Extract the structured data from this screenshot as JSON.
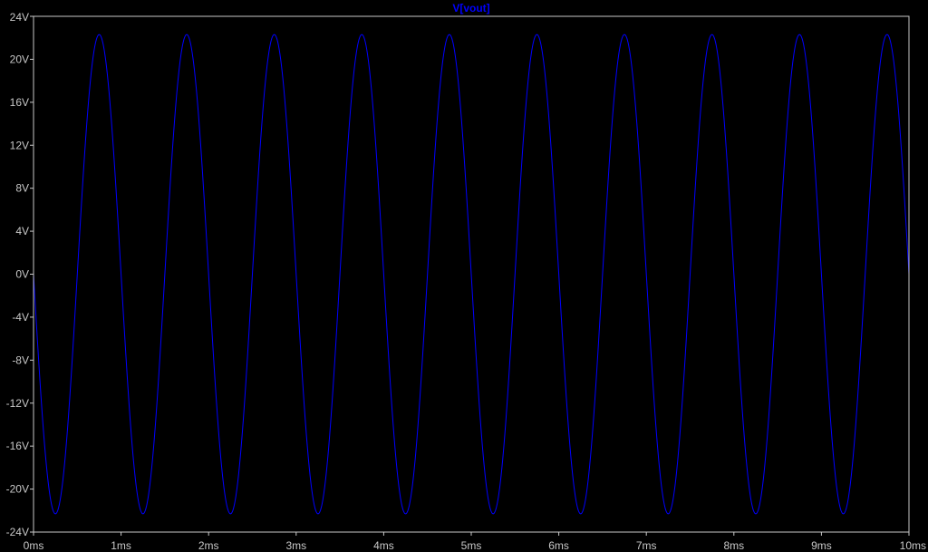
{
  "chart_data": {
    "type": "line",
    "title": "V[vout]",
    "xlabel": "",
    "ylabel": "",
    "x_unit": "ms",
    "y_unit": "V",
    "xlim": [
      0,
      10
    ],
    "ylim": [
      -24,
      24
    ],
    "x_ticks": [
      0,
      1,
      2,
      3,
      4,
      5,
      6,
      7,
      8,
      9,
      10
    ],
    "x_tick_labels": [
      "0ms",
      "1ms",
      "2ms",
      "3ms",
      "4ms",
      "5ms",
      "6ms",
      "7ms",
      "8ms",
      "9ms",
      "10ms"
    ],
    "y_ticks": [
      24,
      20,
      16,
      12,
      8,
      4,
      0,
      -4,
      -8,
      -12,
      -16,
      -20,
      -24
    ],
    "y_tick_labels": [
      "24V",
      "20V",
      "16V",
      "12V",
      "8V",
      "4V",
      "0V",
      "-4V",
      "-8V",
      "-12V",
      "-16V",
      "-20V",
      "-24V"
    ],
    "grid": false,
    "series": [
      {
        "name": "V[vout]",
        "color": "#0000ff",
        "waveform": "sine",
        "frequency_hz": 1000,
        "amplitude_v": 22.3,
        "offset_v": 0,
        "initial_phase": "negative-going",
        "x": [
          0,
          0.25,
          0.5,
          0.75,
          1,
          1.25,
          1.5,
          1.75,
          2,
          2.25,
          2.5,
          2.75,
          3,
          3.25,
          3.5,
          3.75,
          4,
          4.25,
          4.5,
          4.75,
          5,
          5.25,
          5.5,
          5.75,
          6,
          6.25,
          6.5,
          6.75,
          7,
          7.25,
          7.5,
          7.75,
          8,
          8.25,
          8.5,
          8.75,
          9,
          9.25,
          9.5,
          9.75,
          10
        ],
        "y": [
          0,
          -22.3,
          0,
          22.3,
          0,
          -22.3,
          0,
          22.3,
          0,
          -22.3,
          0,
          22.3,
          0,
          -22.3,
          0,
          22.3,
          0,
          -22.3,
          0,
          22.3,
          0,
          -22.3,
          0,
          22.3,
          0,
          -22.3,
          0,
          22.3,
          0,
          -22.3,
          0,
          22.3,
          0,
          -22.3,
          0,
          22.3,
          0,
          -22.3,
          0,
          22.3,
          0
        ]
      }
    ]
  },
  "colors": {
    "background": "#000000",
    "frame": "#c8c8c8",
    "trace": "#0000ff",
    "title": "#0000ff"
  }
}
